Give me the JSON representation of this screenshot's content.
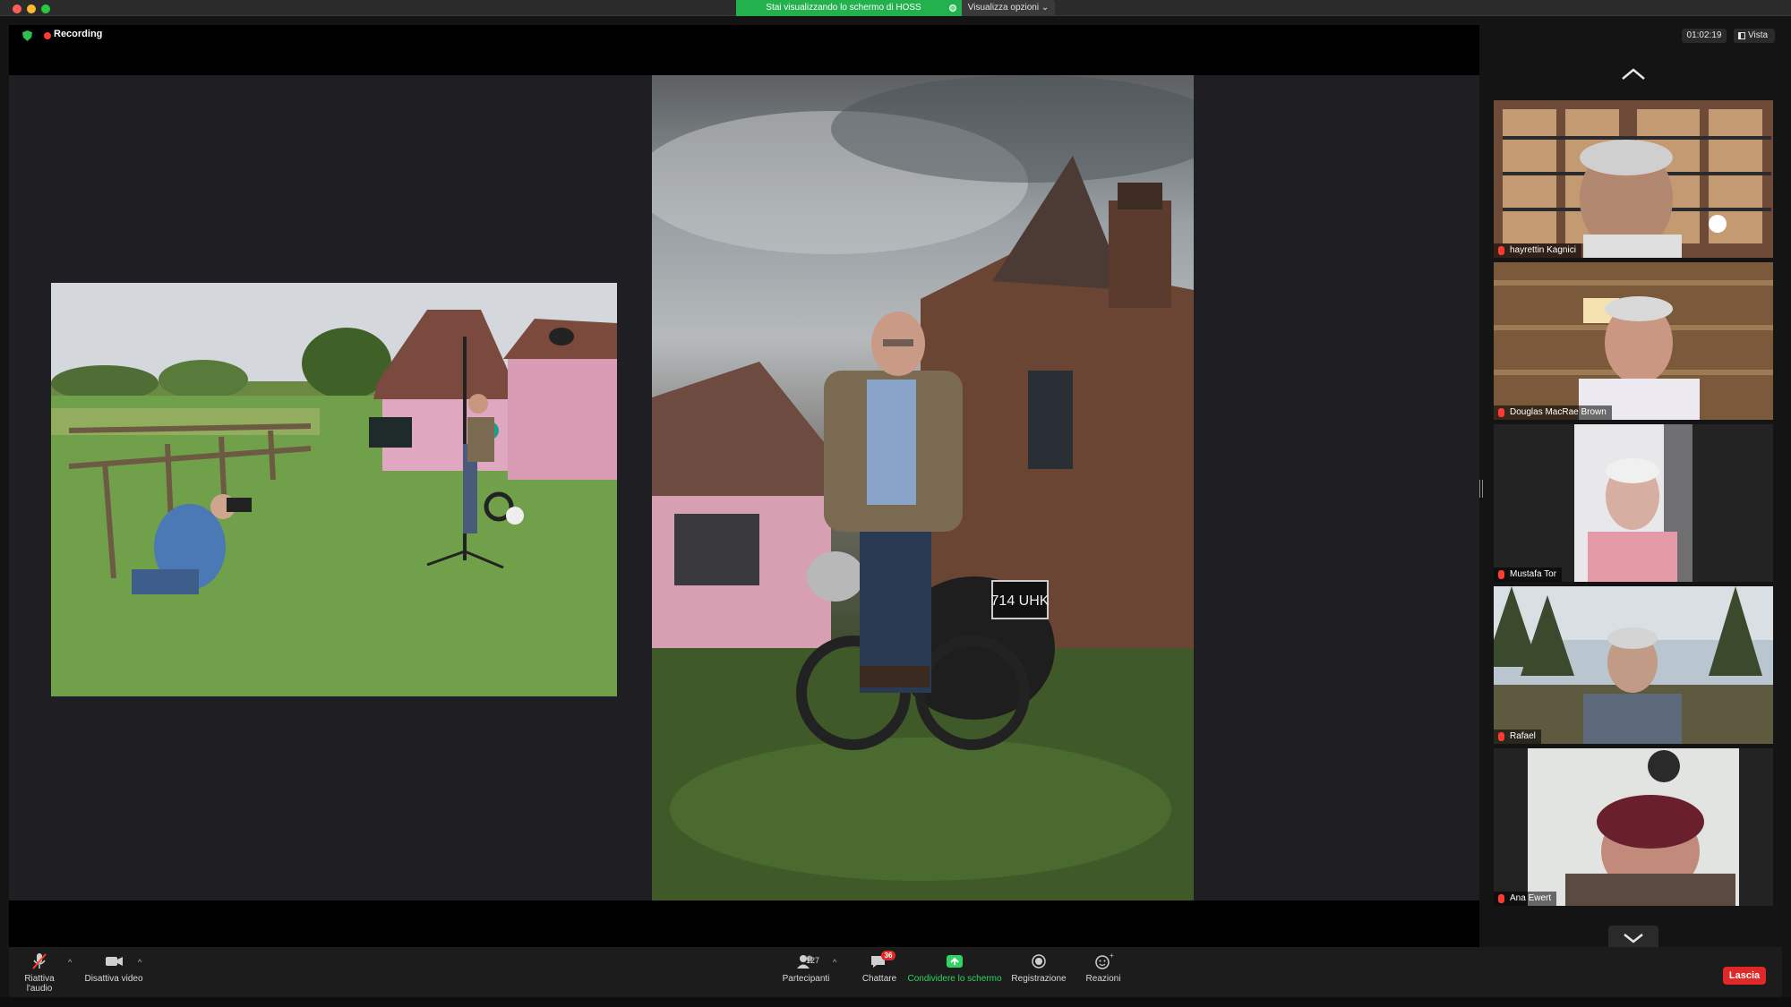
{
  "window": {
    "share_banner": "Stai visualizzando lo schermo di HOSS",
    "view_options": "Visualizza opzioni ⌄"
  },
  "meeting": {
    "recording_label": "Recording",
    "timer": "01:02:19",
    "view_label": "Vista"
  },
  "slide": {
    "plate_text": "714 UHK"
  },
  "participants": [
    {
      "name": "hayrettin Kagnici"
    },
    {
      "name": "Douglas MacRae Brown"
    },
    {
      "name": "Mustafa Tor"
    },
    {
      "name": "Rafael"
    },
    {
      "name": "Ana Ewert"
    }
  ],
  "toolbar": {
    "audio_label": "Riattiva l'audio",
    "video_label": "Disattiva video",
    "participants_label": "Partecipanti",
    "participants_count": "127",
    "chat_label": "Chattare",
    "chat_badge": "36",
    "share_label": "Condividere lo schermo",
    "record_label": "Registrazione",
    "reactions_label": "Reazioni",
    "leave_label": "Lascia"
  },
  "colors": {
    "share_green": "#23b14d",
    "recording_red": "#ff3b30",
    "leave_red": "#e02828"
  }
}
